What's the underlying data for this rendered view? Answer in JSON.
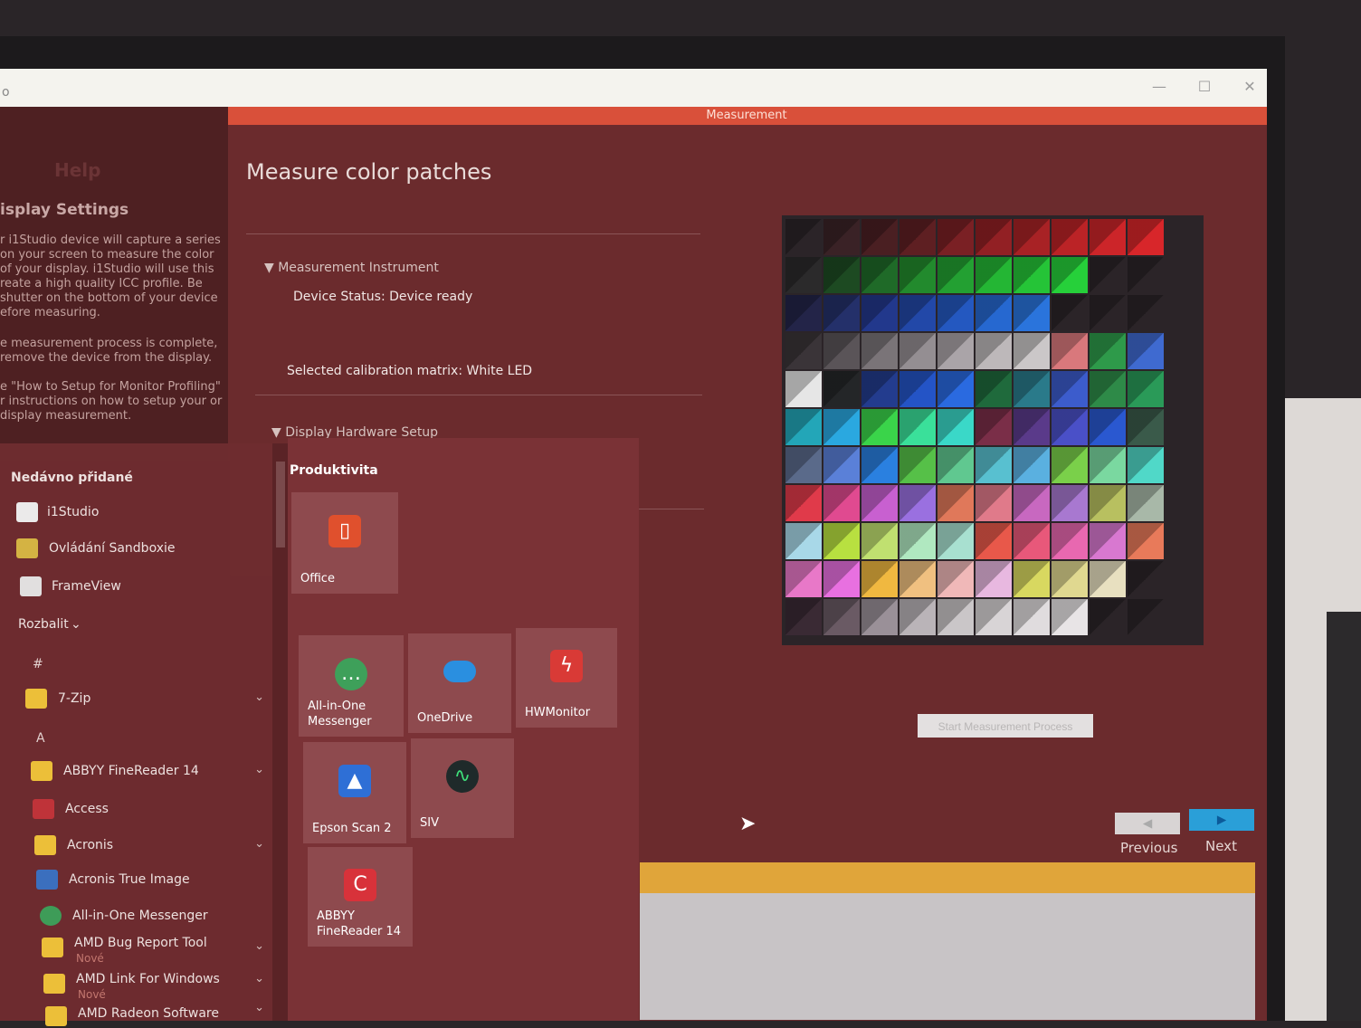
{
  "window": {
    "title": "o",
    "minimize_icon": "minimize-icon",
    "maximize_icon": "maximize-icon",
    "close_icon": "close-icon",
    "minimize_glyph": "—",
    "maximize_glyph": "☐",
    "close_glyph": "✕"
  },
  "top_bar": {
    "label": "Measurement"
  },
  "sidebar": {
    "help": "Help",
    "heading": "isplay Settings",
    "paragraphs": [
      "r i1Studio device will capture a series on your screen to measure the color of your display. i1Studio will use this reate a high quality ICC profile. Be shutter on the bottom of your device efore measuring.",
      "e measurement process is complete, remove the device from the display.",
      "e \"How to Setup for Monitor Profiling\" r instructions on how to setup your or display measurement."
    ]
  },
  "main": {
    "title": "Measure color patches",
    "section_instrument": "Measurement Instrument",
    "device_status": "Device Status: Device ready",
    "calibration_label": "Selected calibration matrix:",
    "calibration_value": "White LED",
    "section_hardware": "Display Hardware Setup",
    "start_button": "Start Measurement Process",
    "previous_label": "Previous",
    "next_label": "Next"
  },
  "start_menu": {
    "recent_heading": "Nedávno přidané",
    "recent": [
      {
        "label": "i1Studio",
        "icon": "document-icon"
      },
      {
        "label": "Ovládání Sandboxie",
        "icon": "sandboxie-icon"
      },
      {
        "label": "FrameView",
        "icon": "frameview-icon"
      }
    ],
    "expand_label": "Rozbalit",
    "letter_hash": "#",
    "letter_a": "A",
    "apps": [
      {
        "label": "7-Zip",
        "icon": "folder-icon",
        "chevron": true
      },
      {
        "label": "ABBYY FineReader 14",
        "icon": "folder-icon",
        "chevron": true
      },
      {
        "label": "Access",
        "icon": "access-icon",
        "chevron": false
      },
      {
        "label": "Acronis",
        "icon": "folder-icon",
        "chevron": true
      },
      {
        "label": "Acronis True Image",
        "icon": "acronis-icon",
        "chevron": false
      },
      {
        "label": "All-in-One Messenger",
        "icon": "messenger-icon",
        "chevron": false
      },
      {
        "label": "AMD Bug Report Tool",
        "icon": "folder-icon",
        "chevron": true,
        "sub": "Nové"
      },
      {
        "label": "AMD Link For Windows",
        "icon": "folder-icon",
        "chevron": true,
        "sub": "Nové"
      },
      {
        "label": "AMD Radeon Software",
        "icon": "folder-icon",
        "chevron": true
      }
    ],
    "tiles_heading": "Produktivita",
    "tiles": {
      "office": "Office",
      "messenger": "All-in-One Messenger",
      "onedrive": "OneDrive",
      "hwmonitor": "HWMonitor",
      "epson": "Epson Scan 2",
      "siv": "SIV",
      "abbyy": "ABBYY FineReader 14"
    }
  },
  "colors": {
    "accent_bar": "#d9503a",
    "panel_bg": "#6b2b2d",
    "next_button": "#2a9fd8",
    "previous_button": "#d8d4d4"
  }
}
